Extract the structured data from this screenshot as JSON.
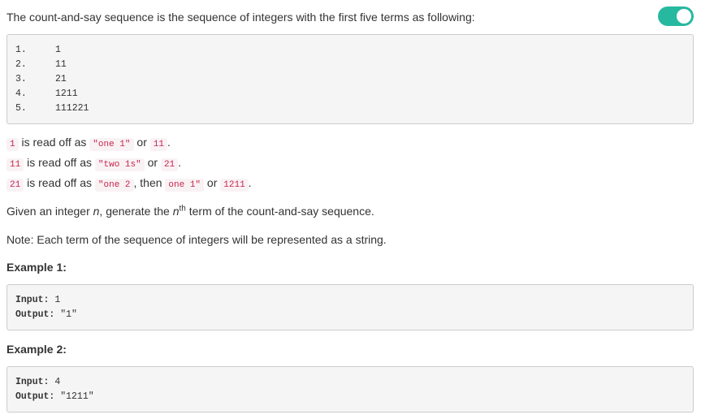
{
  "intro": "The count-and-say sequence is the sequence of integers with the first five terms as following:",
  "toggle": {
    "state": "on",
    "color": "#26b9a0"
  },
  "sequence": [
    {
      "num": "1.",
      "term": "1"
    },
    {
      "num": "2.",
      "term": "11"
    },
    {
      "num": "3.",
      "term": "21"
    },
    {
      "num": "4.",
      "term": "1211"
    },
    {
      "num": "5.",
      "term": "111221"
    }
  ],
  "readoff": [
    {
      "a": "1",
      "t1": " is read off as ",
      "b": "\"one 1\"",
      "t2": " or ",
      "c": "11",
      "t3": "."
    },
    {
      "a": "11",
      "t1": " is read off as ",
      "b": "\"two 1s\"",
      "t2": " or ",
      "c": "21",
      "t3": "."
    },
    {
      "a": "21",
      "t1": " is read off as ",
      "b": "\"one 2",
      "t2": ", then ",
      "c": "one 1\"",
      "t3": " or ",
      "d": "1211",
      "t4": "."
    }
  ],
  "given": {
    "pre": "Given an integer ",
    "n": "n",
    "mid": ", generate the ",
    "n2": "n",
    "sup": "th",
    "post": " term of the count-and-say sequence."
  },
  "note": "Note: Each term of the sequence of integers will be represented as a string.",
  "examples": [
    {
      "heading": "Example 1:",
      "input_key": "Input:",
      "input_val": " 1",
      "output_key": "Output:",
      "output_val": " \"1\""
    },
    {
      "heading": "Example 2:",
      "input_key": "Input:",
      "input_val": " 4",
      "output_key": "Output:",
      "output_val": " \"1211\""
    }
  ],
  "colors": {
    "code_text": "#c7254e",
    "code_bg": "#f9f2f4",
    "pre_bg": "#f5f5f5"
  }
}
